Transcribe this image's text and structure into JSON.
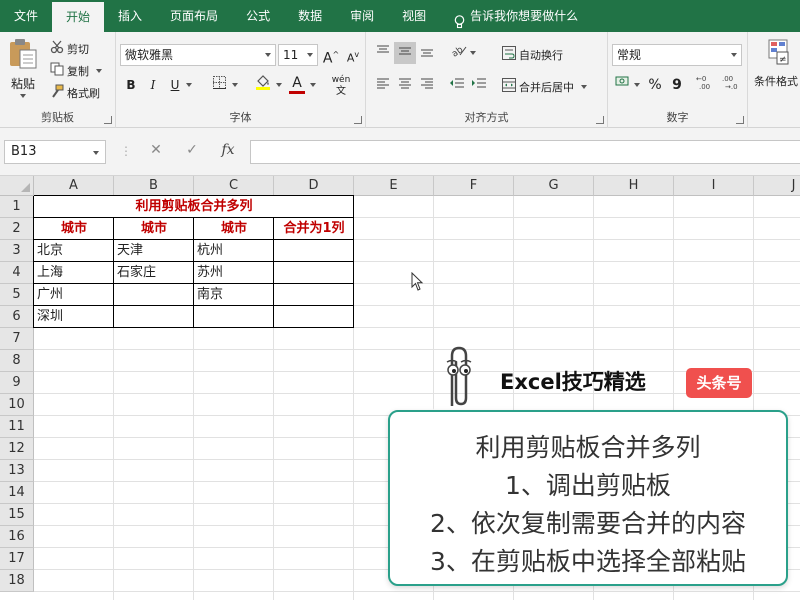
{
  "tabs": [
    "文件",
    "开始",
    "插入",
    "页面布局",
    "公式",
    "数据",
    "审阅",
    "视图"
  ],
  "active_tab_index": 1,
  "tell_me": "告诉我你想要做什么",
  "ribbon": {
    "clipboard": {
      "paste": "粘贴",
      "cut": "剪切",
      "copy": "复制",
      "format_painter": "格式刷",
      "label": "剪贴板"
    },
    "font": {
      "name": "微软雅黑",
      "size": "11",
      "bold": "B",
      "italic": "I",
      "underline": "U",
      "grow": "A",
      "shrink": "A",
      "font_color": "A",
      "phonetic": "wén",
      "label": "字体",
      "font_color_hex": "#c00000",
      "fill_color_hex": "#ffff00"
    },
    "alignment": {
      "wrap_text": "自动换行",
      "merge_center": "合并后居中",
      "label": "对齐方式"
    },
    "number": {
      "format": "常规",
      "percent": "%",
      "comma": "9",
      "inc_decimal": ".00",
      "dec_decimal": ".00",
      "label": "数字"
    },
    "styles": {
      "conditional_format": "条件格式"
    }
  },
  "formula_bar": {
    "name_box": "B13",
    "cancel": "✕",
    "enter": "✓",
    "fx": "fx",
    "value": ""
  },
  "grid": {
    "columns": [
      "A",
      "B",
      "C",
      "D",
      "E",
      "F",
      "G",
      "H",
      "I",
      "J"
    ],
    "rows": [
      "1",
      "2",
      "3",
      "4",
      "5",
      "6",
      "7",
      "8",
      "9",
      "10",
      "11",
      "12",
      "13",
      "14",
      "15",
      "16",
      "17",
      "18"
    ],
    "title": "利用剪贴板合并多列",
    "headers": [
      "城市",
      "城市",
      "城市",
      "合并为1列"
    ],
    "data": [
      [
        "北京",
        "天津",
        "杭州",
        ""
      ],
      [
        "上海",
        "石家庄",
        "苏州",
        ""
      ],
      [
        "广州",
        "",
        "南京",
        ""
      ],
      [
        "深圳",
        "",
        "",
        ""
      ]
    ]
  },
  "overlay": {
    "brand": "Excel技巧精选",
    "badge": "头条号",
    "lines": [
      "利用剪贴板合并多列",
      "1、调出剪贴板",
      "2、依次复制需要合并的内容",
      "3、在剪贴板中选择全部粘贴"
    ]
  },
  "colors": {
    "accent": "#217346",
    "header_text": "#c00000",
    "card_border": "#2aa08a",
    "badge": "#f0504e"
  }
}
